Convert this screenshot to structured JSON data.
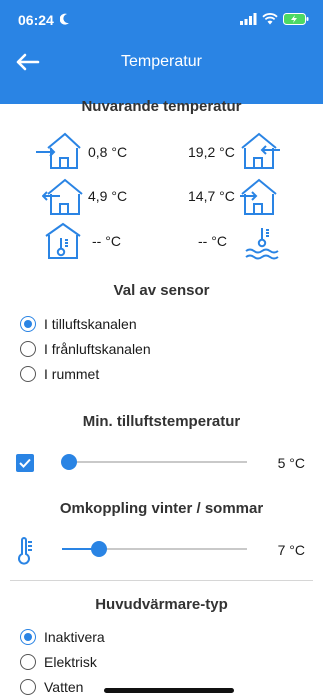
{
  "status_bar": {
    "time": "06:24"
  },
  "header": {
    "title": "Temperatur"
  },
  "current_temperature": {
    "title": "Nuvarande temperatur",
    "readings": [
      {
        "icon": "outdoor-air-in-icon",
        "value": "0,8 °C"
      },
      {
        "icon": "supply-air-icon",
        "value": "19,2 °C"
      },
      {
        "icon": "exhaust-air-icon",
        "value": "4,9 °C"
      },
      {
        "icon": "extract-air-icon",
        "value": "14,7 °C"
      },
      {
        "icon": "room-thermometer-icon",
        "value": "-- °C"
      },
      {
        "icon": "water-thermometer-icon",
        "value": "-- °C"
      }
    ]
  },
  "sensor": {
    "title": "Val av sensor",
    "options": [
      {
        "label": "I tilluftskanalen",
        "selected": true
      },
      {
        "label": "I frånluftskanalen",
        "selected": false
      },
      {
        "label": "I rummet",
        "selected": false
      }
    ]
  },
  "min_supply": {
    "title": "Min. tilluftstemperatur",
    "value": "5 °C",
    "enabled": true,
    "level": 0.02
  },
  "season_switch": {
    "title": "Omkoppling vinter / sommar",
    "value": "7 °C",
    "level": 0.2
  },
  "main_heater": {
    "title": "Huvudvärmare-typ",
    "options": [
      {
        "label": "Inaktivera",
        "selected": true
      },
      {
        "label": "Elektrisk",
        "selected": false
      },
      {
        "label": "Vatten",
        "selected": false
      }
    ]
  },
  "colors": {
    "accent": "#2a84e4"
  }
}
